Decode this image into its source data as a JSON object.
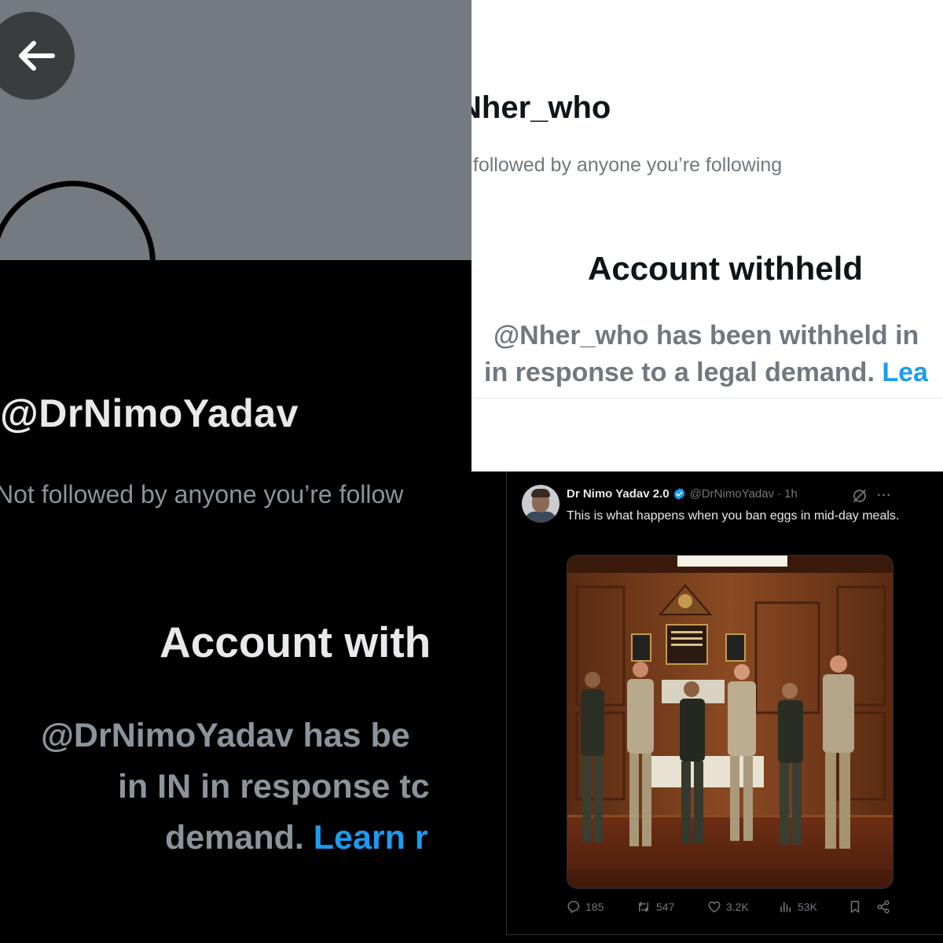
{
  "left_profile": {
    "handle": "@DrNimoYadav",
    "not_followed": "Not followed by anyone you’re follow",
    "withheld_title": "Account with",
    "message_line1": "@DrNimoYadav has be",
    "message_line2": "in IN in response tc",
    "message_line3": "demand. ",
    "learn_more": "Learn r",
    "icons": [
      "back-arrow-icon"
    ]
  },
  "right_profile": {
    "handle": "Nher_who",
    "not_followed": "t followed by anyone you’re following",
    "withheld_title": "Account withheld",
    "message_line1": "@Nher_who has been withheld in",
    "message_line2": "in response to a legal demand. ",
    "learn_more": "Lea"
  },
  "tweet": {
    "author_name": "Dr Nimo Yadav 2.0",
    "handle": "@DrNimoYadav",
    "separator": "·",
    "time": "1h",
    "more": "···",
    "text": "This is what happens when you ban eggs in mid-day meals.",
    "replies": "185",
    "retweets": "547",
    "likes": "3.2K",
    "views": "53K",
    "icons": [
      "verified-icon",
      "grok-icon",
      "more-icon",
      "reply-icon",
      "retweet-icon",
      "like-icon",
      "views-icon",
      "bookmark-icon",
      "share-icon"
    ]
  },
  "colors": {
    "accent_blue": "#1d9bf0",
    "dark_bg": "#000000",
    "banner_gray": "#747a80",
    "muted_text": "#8b949b"
  }
}
